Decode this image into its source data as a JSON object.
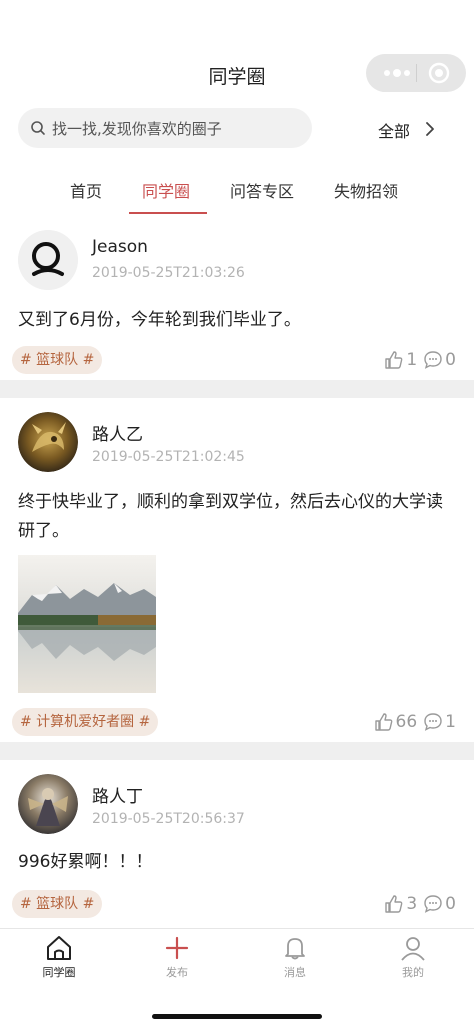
{
  "navbar": {
    "title": "同学圈",
    "capsule": {
      "more_icon": "more-dots-icon",
      "close_icon": "target-icon"
    }
  },
  "search": {
    "placeholder": "找一找,发现你喜欢的圈子",
    "all_label": "全部",
    "icon": "search-icon"
  },
  "tabs": [
    {
      "label": "首页",
      "active": false
    },
    {
      "label": "同学圈",
      "active": true
    },
    {
      "label": "问答专区",
      "active": false
    },
    {
      "label": "失物招领",
      "active": false
    }
  ],
  "posts": [
    {
      "user": "Jeason",
      "time": "2019-05-25T21:03:26",
      "content": "又到了6月份，今年轮到我们毕业了。",
      "tag": "# 篮球队 #",
      "likes": "1",
      "comments": "0"
    },
    {
      "user": "路人乙",
      "time": "2019-05-25T21:02:45",
      "content": "终于快毕业了，顺利的拿到双学位，然后去心仪的大学读研了。",
      "tag": "# 计算机爱好者圈 #",
      "likes": "66",
      "comments": "1"
    },
    {
      "user": "路人丁",
      "time": "2019-05-25T20:56:37",
      "content": "996好累啊！！！",
      "tag": "# 篮球队 #",
      "likes": "3",
      "comments": "0"
    }
  ],
  "tabbar": [
    {
      "label": "同学圈",
      "icon": "home-icon",
      "active": true
    },
    {
      "label": "发布",
      "icon": "plus-icon",
      "active": false
    },
    {
      "label": "消息",
      "icon": "bell-icon",
      "active": false
    },
    {
      "label": "我的",
      "icon": "user-icon",
      "active": false
    }
  ],
  "colors": {
    "accent": "#c94f4f",
    "tag_bg": "#f3e9e2",
    "tag_text": "#b5653f",
    "divider": "#efefef",
    "muted": "#9a9a9a"
  }
}
